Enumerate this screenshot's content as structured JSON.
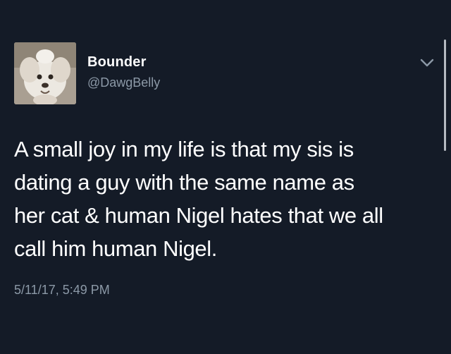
{
  "tweet": {
    "display_name": "Bounder",
    "handle": "@DawgBelly",
    "text": "A small joy in my life is that my sis is\ndating a guy with the same name as\n her cat & human Nigel hates  that we all\ncall him human Nigel.",
    "timestamp": "5/11/17, 5:49 PM",
    "avatar_icon": "dog-avatar",
    "menu_icon": "chevron-down-icon"
  },
  "colors": {
    "background": "#141b27",
    "text": "#ffffff",
    "secondary_text": "#8c99a7"
  }
}
